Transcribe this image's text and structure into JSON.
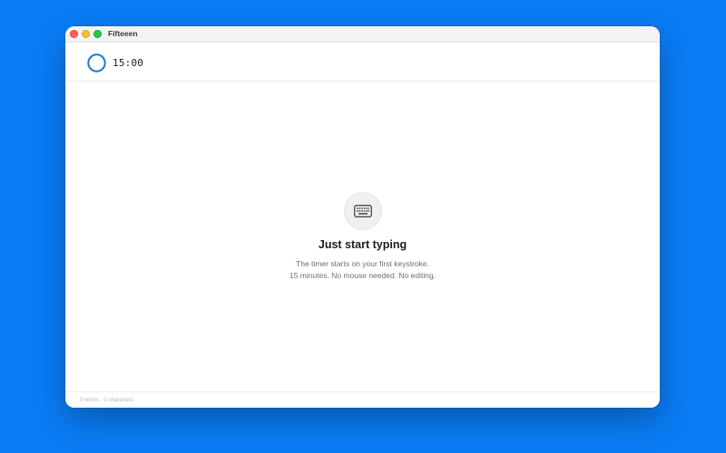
{
  "window": {
    "title": "Fifteeen"
  },
  "header": {
    "timer": "15:00",
    "timer_progress": 1.0
  },
  "empty_state": {
    "icon": "keyboard-icon",
    "title": "Just start typing",
    "line1": "The timer starts on your first keystroke.",
    "line2": "15 minutes. No mouse needed. No editing."
  },
  "footer": {
    "status": "0 words · 0 characters"
  },
  "colors": {
    "desktop_background": "#0a7cf5",
    "timer_ring": "#1a7fd6",
    "close": "#fe5f57",
    "minimize": "#febc2e",
    "zoom": "#28c840"
  }
}
